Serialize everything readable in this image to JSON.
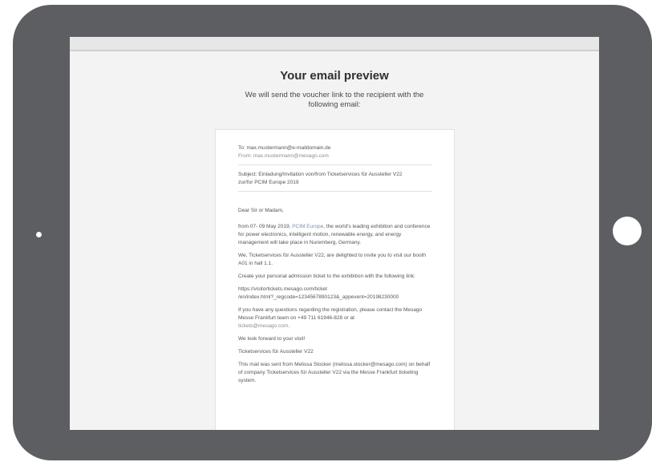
{
  "preview": {
    "title": "Your email preview",
    "subtitle": "We will send the voucher link to the recipient with the following email:"
  },
  "email": {
    "to": "To: max.mustermann@e-maildomain.de",
    "from": "From: max.mustermann@mesago.com",
    "subject_line1": "Subject: Einladung/Invitation von/from Ticketservices für Aussteller V22",
    "subject_line2": "zur/for PCIM Europe 2019",
    "greeting": "Dear Sir or Madam,",
    "p1_prefix": "from 07- 09 May 2019, ",
    "p1_link": "PCIM Europe",
    "p1_rest": ", the world's leading exhibition and conference for power electronics, intelligent motion, renewable energy, and energy management will take place in Nuremberg, Germany.",
    "p2": "We, Ticketservices für Aussteller V22, are delighted to invite you to visit our booth A01 in hall 1.1.",
    "p3": "Create your personal admission ticket to the exhibition with the following link:",
    "url_line1": "https://visitortickets.mesago.com/ticket",
    "url_line2": "/en/index.html?_regcode=1234567890123&_appevent=20198230000",
    "p4": "If you have any questions regarding the registration, please contact the Mesago Messe Frankfurt team on +49 711 61946-828 or at",
    "p4_email": "tickets@mesago.com",
    "p4_end": ".",
    "p5": "We look forward to your visit!",
    "signature": "Ticketservices für Aussteller V22",
    "p6": "This mail was sent from Melissa Stocker (melissa.stocker@mesago.com) on behalf of company Ticketservices für Aussteller V22 via the Messe Frankfurt ticketing system."
  }
}
